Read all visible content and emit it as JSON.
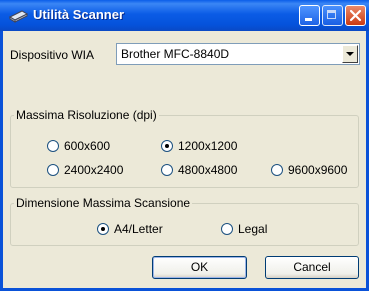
{
  "window": {
    "title": "Utilità Scanner",
    "title_icon": "scanner-icon",
    "buttons": [
      "minimize-icon",
      "maximize-icon",
      "close-icon"
    ]
  },
  "device": {
    "label": "Dispositivo WIA",
    "selected": "Brother MFC-8840D"
  },
  "resolution": {
    "legend": "Massima Risoluzione (dpi)",
    "options": [
      "600x600",
      "1200x1200",
      "2400x2400",
      "4800x4800",
      "9600x9600"
    ],
    "selected": "1200x1200"
  },
  "scan_size": {
    "legend": "Dimensione Massima Scansione",
    "options": [
      "A4/Letter",
      "Legal"
    ],
    "selected": "A4/Letter"
  },
  "actions": {
    "ok": "OK",
    "cancel": "Cancel"
  },
  "colors": {
    "titlebar": "#0552db",
    "dialog_bg": "#ece9d8",
    "close_button": "#cc3a12"
  }
}
